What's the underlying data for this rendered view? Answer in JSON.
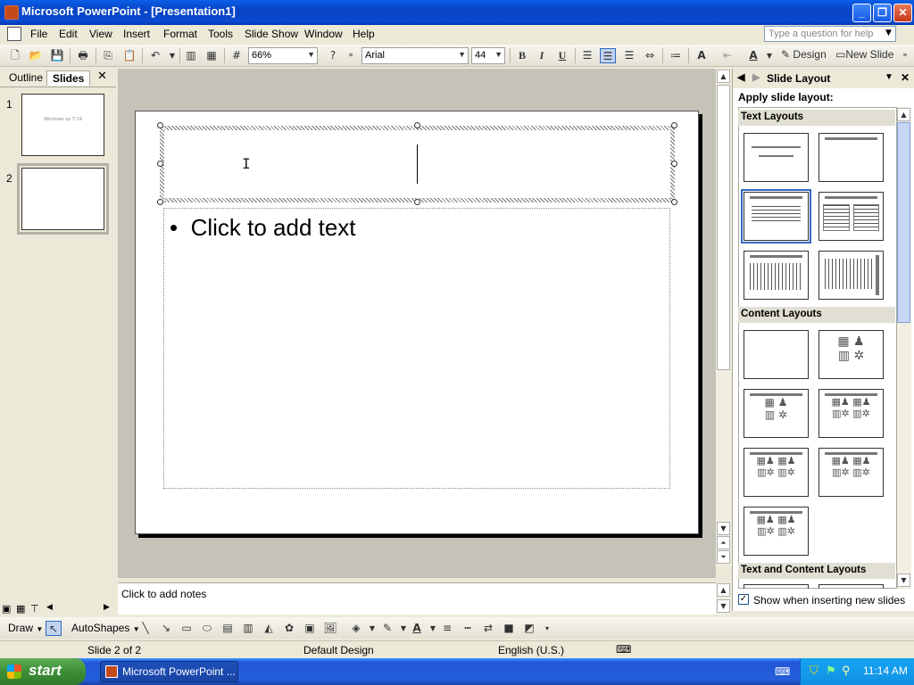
{
  "window": {
    "title": "Microsoft PowerPoint - [Presentation1]",
    "minimize": "_",
    "restore": "❐",
    "close": "✕"
  },
  "menu": [
    "File",
    "Edit",
    "View",
    "Insert",
    "Format",
    "Tools",
    "Slide Show",
    "Window",
    "Help"
  ],
  "help_placeholder": "Type a question for help",
  "toolbar": {
    "zoom": "66%",
    "font": "Arial",
    "font_size": "44",
    "bold": "B",
    "italic": "I",
    "underline": "U",
    "design_label": "Design",
    "new_slide_label": "New Slide"
  },
  "left_pane": {
    "tabs": [
      "Outline",
      "Slides"
    ],
    "close": "✕",
    "thumbnails": [
      {
        "number": "1",
        "text": "Windows xp 7.19"
      },
      {
        "number": "2",
        "text": ""
      }
    ]
  },
  "slide": {
    "body_placeholder": "Click to add text",
    "bullet": "•"
  },
  "notes_placeholder": "Click to add notes",
  "task_pane": {
    "title": "Slide Layout",
    "apply_label": "Apply slide layout:",
    "sections": [
      "Text Layouts",
      "Content Layouts",
      "Text and Content Layouts"
    ],
    "show_when_inserting": "Show when inserting new slides"
  },
  "drawbar": {
    "draw_label": "Draw",
    "autoshapes_label": "AutoShapes"
  },
  "status": {
    "slide_of": "Slide 2 of 2",
    "design": "Default Design",
    "language": "English (U.S.)"
  },
  "taskbar": {
    "start_label": "start",
    "task_item": "Microsoft PowerPoint ...",
    "clock": "11:14 AM"
  }
}
